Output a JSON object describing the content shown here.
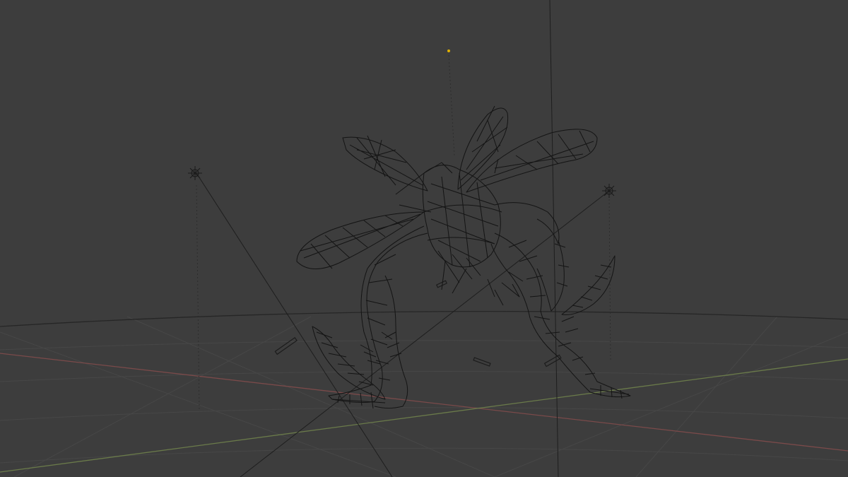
{
  "viewport": {
    "mode": "wireframe",
    "background_color": "#3d3d3d",
    "grid_color": "#4a4a4a",
    "x_axis_color": "#7a4a4a",
    "y_axis_color": "#6a7a4a",
    "wire_color": "#111111",
    "object": "winged-creature-wireframe-mesh",
    "lights": [
      "light-left",
      "light-right"
    ],
    "camera_target_color": "#e0b000"
  }
}
